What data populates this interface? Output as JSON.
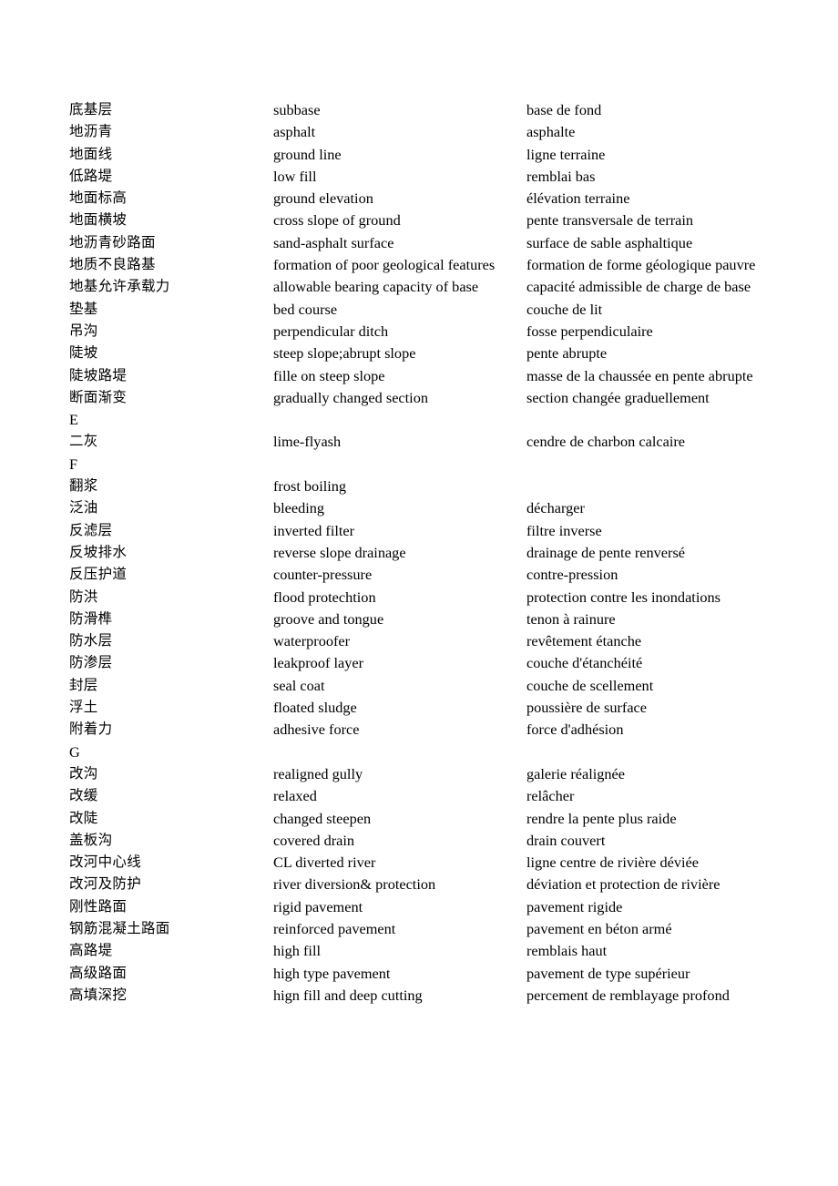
{
  "document": {
    "type": "glossary",
    "columns": [
      "chinese",
      "english",
      "french"
    ],
    "page_background": "#ffffff",
    "text_color": "#000000"
  },
  "entries": [
    {
      "kind": "term",
      "cn": "底基层",
      "en": "subbase",
      "fr": "base de fond"
    },
    {
      "kind": "term",
      "cn": "地沥青",
      "en": "asphalt",
      "fr": "asphalte"
    },
    {
      "kind": "term",
      "cn": "地面线",
      "en": "ground line",
      "fr": "ligne terraine"
    },
    {
      "kind": "term",
      "cn": "低路堤",
      "en": "low fill",
      "fr": "remblai bas"
    },
    {
      "kind": "term",
      "cn": "地面标高",
      "en": "ground elevation",
      "fr": "élévation terraine"
    },
    {
      "kind": "term",
      "cn": "地面横坡",
      "en": "cross slope of ground",
      "fr": "pente transversale de terrain"
    },
    {
      "kind": "term",
      "cn": "地沥青砂路面",
      "en": "sand-asphalt surface",
      "fr": "surface de sable asphaltique"
    },
    {
      "kind": "term",
      "cn": "地质不良路基",
      "en": "formation of poor geological features",
      "fr": "formation de forme géologique pauvre"
    },
    {
      "kind": "term",
      "cn": "地基允许承载力",
      "en": "allowable bearing capacity of base",
      "fr": "capacité admissible de charge de base"
    },
    {
      "kind": "term",
      "cn": "垫基",
      "en": "bed course",
      "fr": "couche de lit"
    },
    {
      "kind": "term",
      "cn": "吊沟",
      "en": "perpendicular ditch",
      "fr": "fosse perpendiculaire"
    },
    {
      "kind": "term",
      "cn": "陡坡",
      "en": "steep slope;abrupt slope",
      "fr": "pente abrupte"
    },
    {
      "kind": "term",
      "cn": "陡坡路堤",
      "en": "fille on steep slope",
      "fr": "masse de la chaussée en pente abrupte"
    },
    {
      "kind": "term",
      "cn": "断面渐变",
      "en": "gradually changed section",
      "fr": "section changée graduellement"
    },
    {
      "kind": "section",
      "letter": "E"
    },
    {
      "kind": "term",
      "cn": "二灰",
      "en": "lime-flyash",
      "fr": "cendre de charbon calcaire"
    },
    {
      "kind": "section",
      "letter": "F"
    },
    {
      "kind": "term",
      "cn": "翻浆",
      "en": "frost boiling",
      "fr": ""
    },
    {
      "kind": "term",
      "cn": "泛油",
      "en": "bleeding",
      "fr": "décharger"
    },
    {
      "kind": "term",
      "cn": "反滤层",
      "en": "inverted filter",
      "fr": "filtre inverse"
    },
    {
      "kind": "term",
      "cn": "反坡排水",
      "en": "reverse slope drainage",
      "fr": "drainage de pente renversé"
    },
    {
      "kind": "term",
      "cn": "反压护道",
      "en": "counter-pressure",
      "fr": "contre-pression"
    },
    {
      "kind": "term",
      "cn": "防洪",
      "en": "flood protechtion",
      "fr": "protection contre les inondations"
    },
    {
      "kind": "term",
      "cn": "防滑榫",
      "en": "groove and tongue",
      "fr": "tenon à rainure"
    },
    {
      "kind": "term",
      "cn": "防水层",
      "en": "waterproofer",
      "fr": "revêtement étanche"
    },
    {
      "kind": "term",
      "cn": "防渗层",
      "en": "leakproof layer",
      "fr": "couche d'étanchéité"
    },
    {
      "kind": "term",
      "cn": "封层",
      "en": "seal coat",
      "fr": "couche de scellement"
    },
    {
      "kind": "term",
      "cn": "浮土",
      "en": "floated sludge",
      "fr": "poussière de surface"
    },
    {
      "kind": "term",
      "cn": "附着力",
      "en": "adhesive force",
      "fr": "force d'adhésion"
    },
    {
      "kind": "section",
      "letter": "G"
    },
    {
      "kind": "term",
      "cn": "改沟",
      "en": "realigned gully",
      "fr": "galerie réalignée"
    },
    {
      "kind": "term",
      "cn": "改缓",
      "en": "relaxed",
      "fr": "relâcher"
    },
    {
      "kind": "term",
      "cn": "改陡",
      "en": "changed steepen",
      "fr": "rendre la pente plus raide"
    },
    {
      "kind": "term",
      "cn": "盖板沟",
      "en": "covered drain",
      "fr": "drain couvert"
    },
    {
      "kind": "term",
      "cn": "改河中心线",
      "en": "CL diverted river",
      "fr": "ligne centre de rivière déviée"
    },
    {
      "kind": "term",
      "cn": "改河及防护",
      "en": "river diversion& protection",
      "fr": "déviation et protection de rivière"
    },
    {
      "kind": "term",
      "cn": "刚性路面",
      "en": "rigid pavement",
      "fr": "pavement rigide"
    },
    {
      "kind": "term",
      "cn": "钢筋混凝土路面",
      "en": "reinforced pavement",
      "fr": "pavement en béton armé"
    },
    {
      "kind": "term",
      "cn": "高路堤",
      "en": "high fill",
      "fr": "remblais haut"
    },
    {
      "kind": "term",
      "cn": "高级路面",
      "en": "high type pavement",
      "fr": "pavement de type supérieur"
    },
    {
      "kind": "term",
      "cn": "高填深挖",
      "en": "hign fill and deep cutting",
      "fr": "percement de remblayage profond"
    }
  ]
}
